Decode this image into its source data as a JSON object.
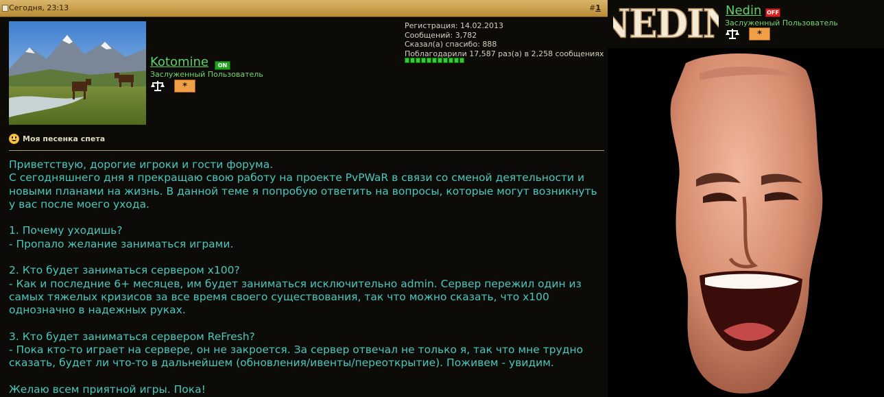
{
  "post": {
    "date": "Сегодня, 23:13",
    "number_prefix": "#",
    "number": "1",
    "author": {
      "name": "Kotomine",
      "status_badge": "ON",
      "title": "Заслуженный Пользователь",
      "star_label": "*"
    },
    "stats": [
      "Регистрация: 14.02.2013",
      "Сообщений: 3,782",
      "Сказал(а) спасибо: 888",
      "Поблагодарили 17,587 раз(а) в 2,258 сообщениях"
    ],
    "reputation_segments": 11,
    "mood": "Моя песенка спета",
    "message_paragraphs": [
      "Приветствую, дорогие игроки и гости форума.\nС сегодняшнего дня я прекращаю свою работу на проекте PvPWaR в связи со сменой деятельности и новыми планами на жизнь. В данной теме я попробую ответить на вопросы, которые могут возникнуть у вас после моего ухода.",
      "1. Почему уходишь?\n- Пропало желание заниматься играми.",
      "2. Кто будет заниматься сервером x100?\n- Как и последние 6+ месяцев, им будет заниматься исключительно admin. Сервер пережил один из самых тяжелых кризисов за все время своего существования, так что можно сказать, что x100 однозначно в надежных руках.",
      "3. Кто будет заниматься сервером ReFresh?\n- Пока кто-то играет на сервере, он не закроется. За сервер отвечал не только я, так что мне трудно сказать, будет ли что-то в дальнейшем (обновления/ивенты/переоткрытие). Поживем - увидим.",
      "Желаю всем приятной игры. Пока!"
    ]
  },
  "side": {
    "logo_text": "NEDIN",
    "name": "Nedin",
    "status_badge": "OFF",
    "title": "Заслуженный Пользователь",
    "star_label": "*"
  },
  "colors": {
    "username": "#5fd16a",
    "message_text": "#49c8bd",
    "header_gold": "#c9a04c",
    "online": "#1fa21f",
    "offline": "#d82222"
  }
}
